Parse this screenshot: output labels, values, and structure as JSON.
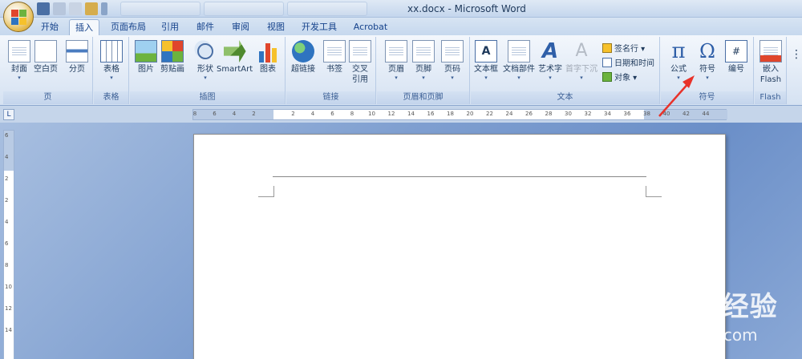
{
  "window": {
    "title": "xx.docx - Microsoft Word"
  },
  "tabs": [
    {
      "label": "开始"
    },
    {
      "label": "插入"
    },
    {
      "label": "页面布局"
    },
    {
      "label": "引用"
    },
    {
      "label": "邮件"
    },
    {
      "label": "审阅"
    },
    {
      "label": "视图"
    },
    {
      "label": "开发工具"
    },
    {
      "label": "Acrobat"
    }
  ],
  "groups": {
    "page": {
      "label": "页",
      "buttons": [
        {
          "label": "封面"
        },
        {
          "label": "空白页"
        },
        {
          "label": "分页"
        }
      ]
    },
    "table": {
      "label": "表格",
      "buttons": [
        {
          "label": "表格"
        }
      ]
    },
    "illustrations": {
      "label": "插图",
      "buttons": [
        {
          "label": "图片"
        },
        {
          "label": "剪贴画"
        },
        {
          "label": "形状"
        },
        {
          "label": "SmartArt"
        },
        {
          "label": "图表"
        }
      ]
    },
    "links": {
      "label": "链接",
      "buttons": [
        {
          "label": "超链接"
        },
        {
          "label": "书签"
        },
        {
          "label": "交叉"
        },
        {
          "label": "引用"
        }
      ]
    },
    "header_footer": {
      "label": "页眉和页脚",
      "buttons": [
        {
          "label": "页眉"
        },
        {
          "label": "页脚"
        },
        {
          "label": "页码"
        }
      ]
    },
    "text": {
      "label": "文本",
      "buttons": [
        {
          "label": "文本框"
        },
        {
          "label": "文档部件"
        },
        {
          "label": "艺术字"
        },
        {
          "label": "首字下沉"
        }
      ],
      "small": [
        {
          "label": "签名行 ▾"
        },
        {
          "label": "日期和时间"
        },
        {
          "label": "对象 ▾"
        }
      ]
    },
    "symbols": {
      "label": "符号",
      "buttons": [
        {
          "label": "公式"
        },
        {
          "label": "符号"
        },
        {
          "label": "编号"
        }
      ]
    },
    "flash": {
      "label": "Flash",
      "buttons": [
        {
          "label": "嵌入"
        },
        {
          "label": "Flash"
        }
      ]
    }
  },
  "ruler": {
    "h_ticks_left": [
      "8",
      "6",
      "4",
      "2"
    ],
    "h_ticks_right": [
      "2",
      "4",
      "6",
      "8",
      "10",
      "12",
      "14",
      "16",
      "18",
      "20",
      "22",
      "24",
      "26",
      "28",
      "30",
      "32",
      "34",
      "36",
      "38",
      "40",
      "42",
      "44"
    ],
    "v_ticks": [
      "6",
      "4",
      "2",
      "2",
      "4",
      "6",
      "8",
      "10",
      "12",
      "14"
    ]
  },
  "watermark": {
    "line1": "Bai du 经验",
    "line2": "jingyan.baidu.com"
  },
  "colors": {
    "accent": "#15428b",
    "arrow": "#e8322a"
  }
}
